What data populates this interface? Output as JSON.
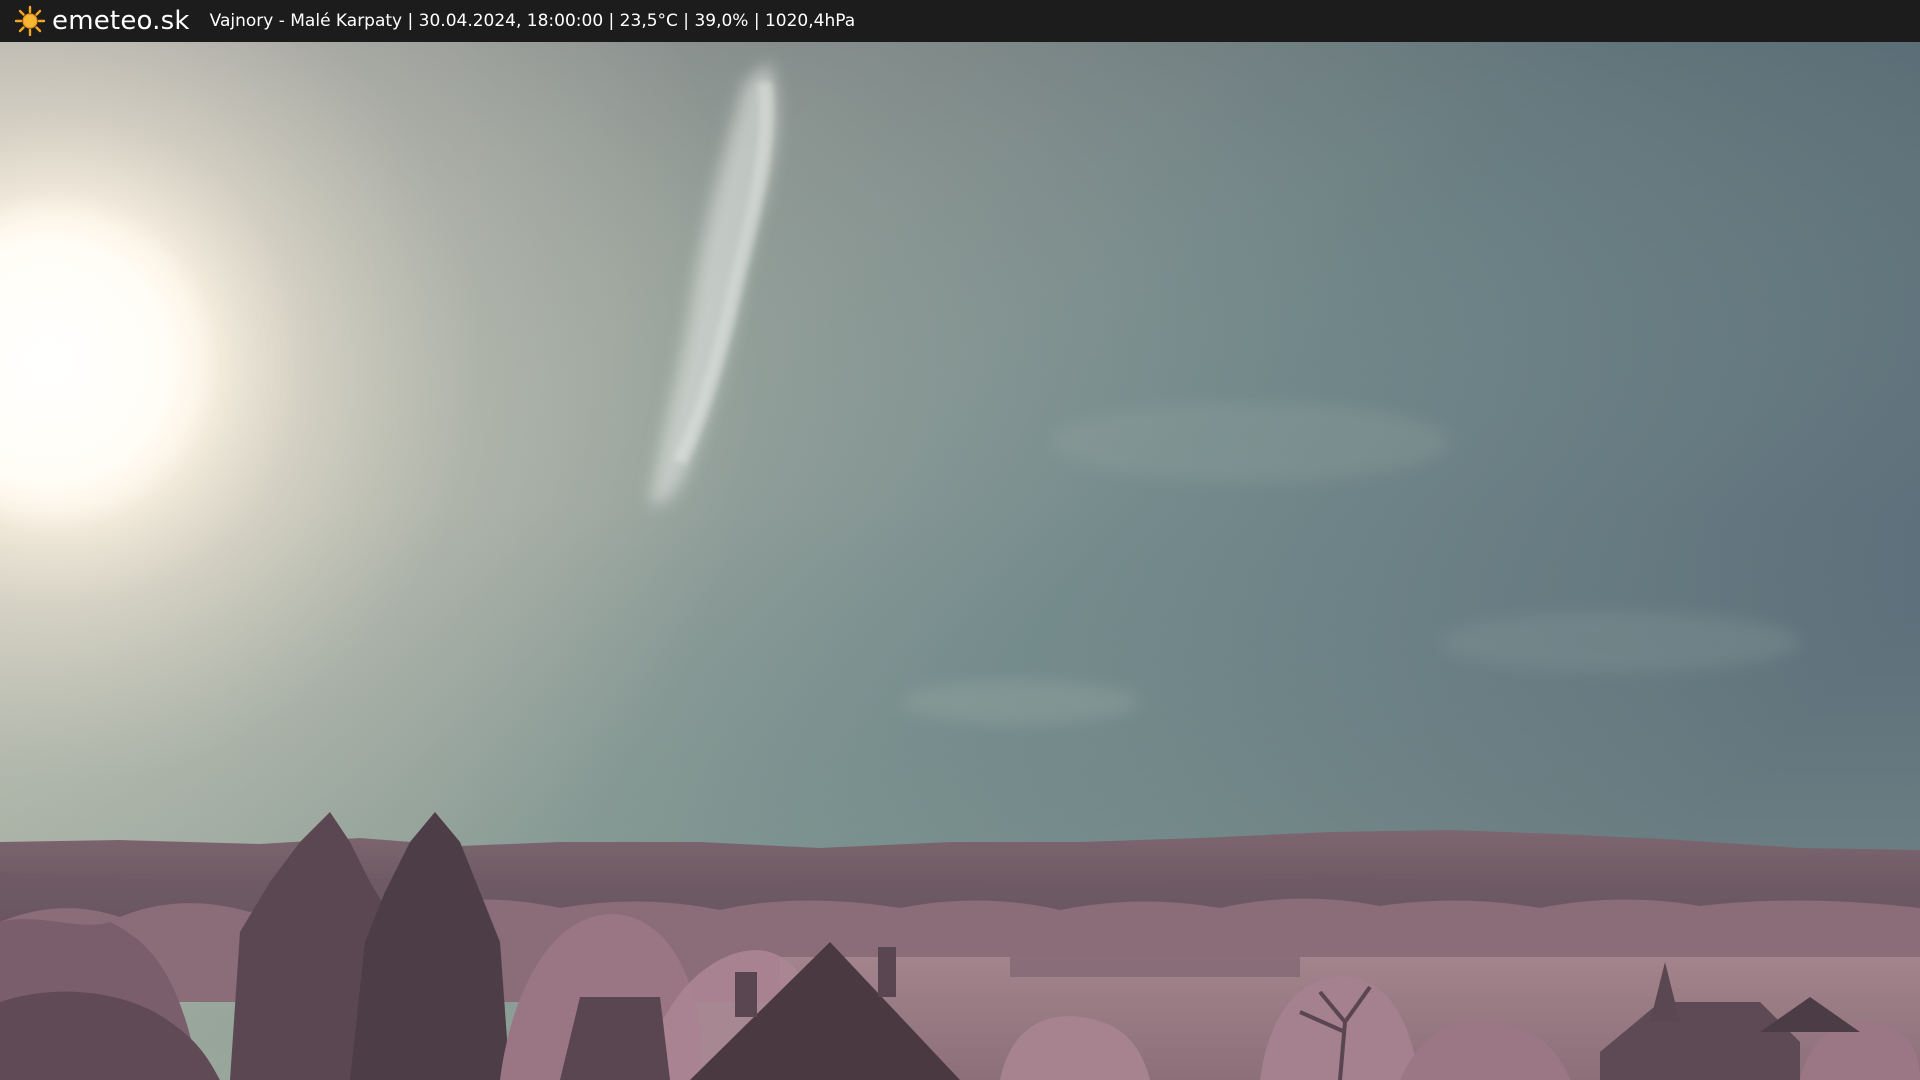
{
  "header": {
    "logo_icon": "sun-icon",
    "brand": "emeteo.sk",
    "info": "Vajnory - Malé Karpaty | 30.04.2024, 18:00:00 | 23,5°C | 39,0% | 1020,4hPa"
  },
  "colors": {
    "bar_background": "#1c1c1c",
    "sun_orange": "#f5a623",
    "sky_teal": "#6e8d8a",
    "sky_slate": "#566a78",
    "foliage_mauve": "#9c7785"
  }
}
